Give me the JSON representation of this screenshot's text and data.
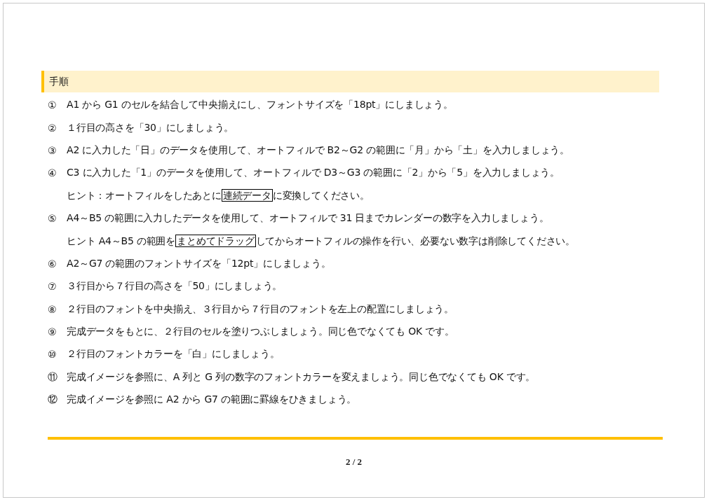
{
  "section": {
    "title": "手順"
  },
  "steps": [
    {
      "kind": "step",
      "number": "①",
      "text": "A1 から G1 のセルを結合して中央揃えにし、フォントサイズを「18pt」にしましょう。"
    },
    {
      "kind": "step",
      "number": "②",
      "text": "１行目の高さを「30」にしましょう。"
    },
    {
      "kind": "step",
      "number": "③",
      "text": "A2 に入力した「日」のデータを使用して、オートフィルで B2～G2 の範囲に「月」から「土」を入力しましょう。"
    },
    {
      "kind": "step",
      "number": "④",
      "text": "C3 に入力した「1」のデータを使用して、オートフィルで D3～G3 の範囲に「2」から「5」を入力しましょう。"
    },
    {
      "kind": "hint",
      "before": "ヒント：オートフィルをしたあとに",
      "boxed": "連続データ",
      "after": "に変換してください。"
    },
    {
      "kind": "step",
      "number": "⑤",
      "text": "A4～B5 の範囲に入力したデータを使用して、オートフィルで 31 日までカレンダーの数字を入力しましょう。"
    },
    {
      "kind": "hint",
      "before": "ヒント A4～B5 の範囲を",
      "boxed": "まとめてドラッグ",
      "after": "してからオートフィルの操作を行い、必要ない数字は削除してください。"
    },
    {
      "kind": "step",
      "number": "⑥",
      "text": "A2～G7 の範囲のフォントサイズを「12pt」にしましょう。"
    },
    {
      "kind": "step",
      "number": "⑦",
      "text": "３行目から７行目の高さを「50」にしましょう。"
    },
    {
      "kind": "step",
      "number": "⑧",
      "text": "２行目のフォントを中央揃え、３行目から７行目のフォントを左上の配置にしましょう。"
    },
    {
      "kind": "step",
      "number": "⑨",
      "text": "完成データをもとに、２行目のセルを塗りつぶしましょう。同じ色でなくても OK です。"
    },
    {
      "kind": "step",
      "number": "⑩",
      "text": "２行目のフォントカラーを「白」にしましょう。"
    },
    {
      "kind": "step",
      "number": "⑪",
      "text": "完成イメージを参照に、A 列と G 列の数字のフォントカラーを変えましょう。同じ色でなくても OK です。"
    },
    {
      "kind": "step",
      "number": "⑫",
      "text": "完成イメージを参照に A2 から G7 の範囲に罫線をひきましょう。"
    }
  ],
  "page_number": "2 / 2"
}
